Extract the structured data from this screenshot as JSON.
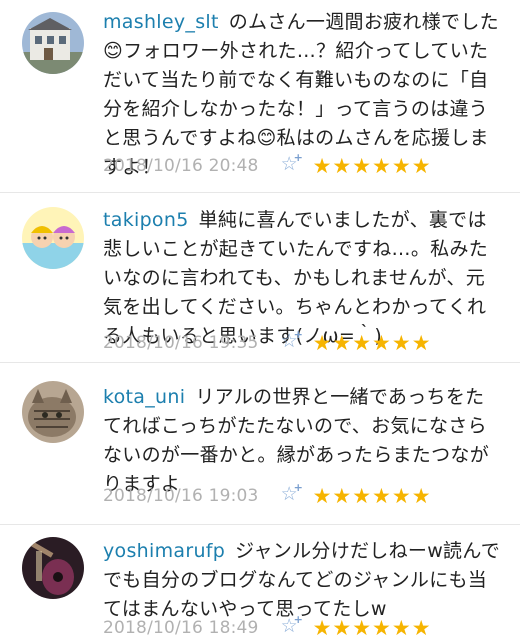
{
  "comments": [
    {
      "username": "mashley_slt",
      "text": "のムさん一週間お疲れ様でした😊フォロワー外された…？紹介ってしていただいて当たり前でなく有難いものなのに「自分を紹介しなかったな！」って言うのは違うと思うんですよね😊私はのムさんを応援しますよ！",
      "date": "2018/10/16 20:48",
      "star_add_icon": "star-plus-icon",
      "stars": "★★★★★★",
      "avatar_icon": "house-photo-avatar"
    },
    {
      "username": "takipon5",
      "text": "単純に喜んでいましたが、裏では悲しいことが起きていたんですね…。私みたいなのに言われても、かもしれませんが、元気を出してください。ちゃんとわかってくれる人もいると思います(ノω=｀)",
      "date": "2018/10/16 19:35",
      "star_add_icon": "star-plus-icon",
      "stars": "★★★★★★",
      "avatar_icon": "illustration-avatar"
    },
    {
      "username": "kota_uni",
      "text": "リアルの世界と一緒であっちをたてればこっちがたたないので、お気になさらないのが一番かと。縁があったらまたつながりますよ",
      "date": "2018/10/16 19:03",
      "star_add_icon": "star-plus-icon",
      "stars": "★★★★★★",
      "avatar_icon": "cat-photo-avatar"
    },
    {
      "username": "yoshimarufp",
      "text": "ジャンル分けだしねーw読んででも自分のブログなんてどのジャンルにも当てはまんないやって思ってたしw",
      "date": "2018/10/16 18:49",
      "star_add_icon": "star-plus-icon",
      "stars": "★★★★★★",
      "avatar_icon": "guitar-photo-avatar"
    }
  ]
}
